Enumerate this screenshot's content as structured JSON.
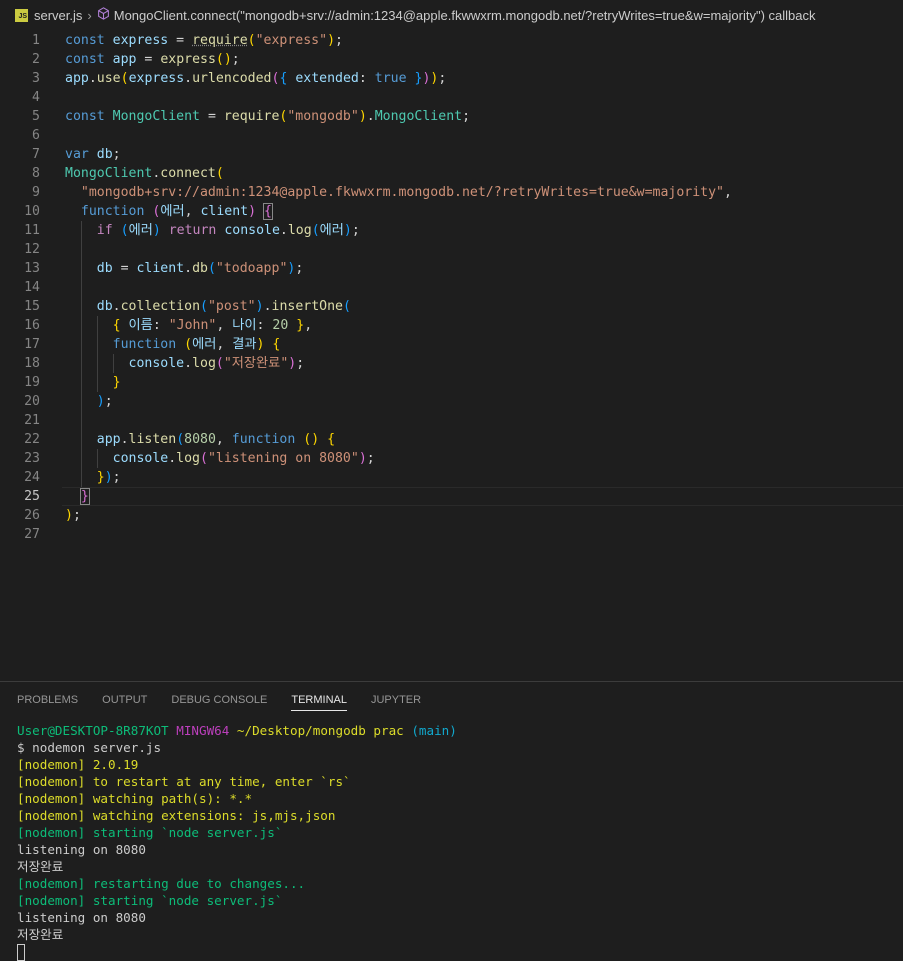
{
  "breadcrumb": {
    "file": "server.js",
    "symbol": "MongoClient.connect(\"mongodb+srv://admin:1234@apple.fkwwxrm.mongodb.net/?retryWrites=true&w=majority\") callback"
  },
  "editor": {
    "line_numbers": [
      "1",
      "2",
      "3",
      "4",
      "5",
      "6",
      "7",
      "8",
      "9",
      "10",
      "11",
      "12",
      "13",
      "14",
      "15",
      "16",
      "17",
      "18",
      "19",
      "20",
      "21",
      "22",
      "23",
      "24",
      "25",
      "26",
      "27"
    ],
    "tokens": {
      "const": "const",
      "express": "express",
      "require": "require",
      "express_str": "\"express\"",
      "app": "app",
      "use": "use",
      "urlencoded": "urlencoded",
      "extended": "extended",
      "true": "true",
      "MongoClient": "MongoClient",
      "mongodb_str": "\"mongodb\"",
      "var": "var",
      "db": "db",
      "connect": "connect",
      "uri": "\"mongodb+srv://admin:1234@apple.fkwwxrm.mongodb.net/?retryWrites=true&w=majority\"",
      "function": "function",
      "err": "에러",
      "client": "client",
      "if": "if",
      "return": "return",
      "console": "console",
      "log": "log",
      "todoapp": "\"todoapp\"",
      "collection": "collection",
      "post": "\"post\"",
      "insertOne": "insertOne",
      "name_key": "이름",
      "john": "\"John\"",
      "age_key": "나이",
      "twenty": "20",
      "result": "결과",
      "saved": "\"저장완료\"",
      "listen": "listen",
      "port": "8080",
      "listening": "\"listening on 8080\""
    }
  },
  "panel": {
    "tabs": [
      "PROBLEMS",
      "OUTPUT",
      "DEBUG CONSOLE",
      "TERMINAL",
      "JUPYTER"
    ],
    "active_tab": "TERMINAL"
  },
  "terminal": {
    "prompt_user": "User@DESKTOP-8R87KOT",
    "prompt_env": "MINGW64",
    "prompt_path": "~/Desktop/mongodb prac",
    "prompt_branch": "(main)",
    "command": "$ nodemon server.js",
    "nodemon_tag": "[nodemon]",
    "version": "2.0.19",
    "restart_hint": "to restart at any time, enter `rs`",
    "watching_paths": "watching path(s): *.*",
    "watching_ext": "watching extensions: js,mjs,json",
    "starting": "starting `node server.js`",
    "listening": "listening on 8080",
    "saved": "저장완료",
    "restarting": "restarting due to changes..."
  }
}
